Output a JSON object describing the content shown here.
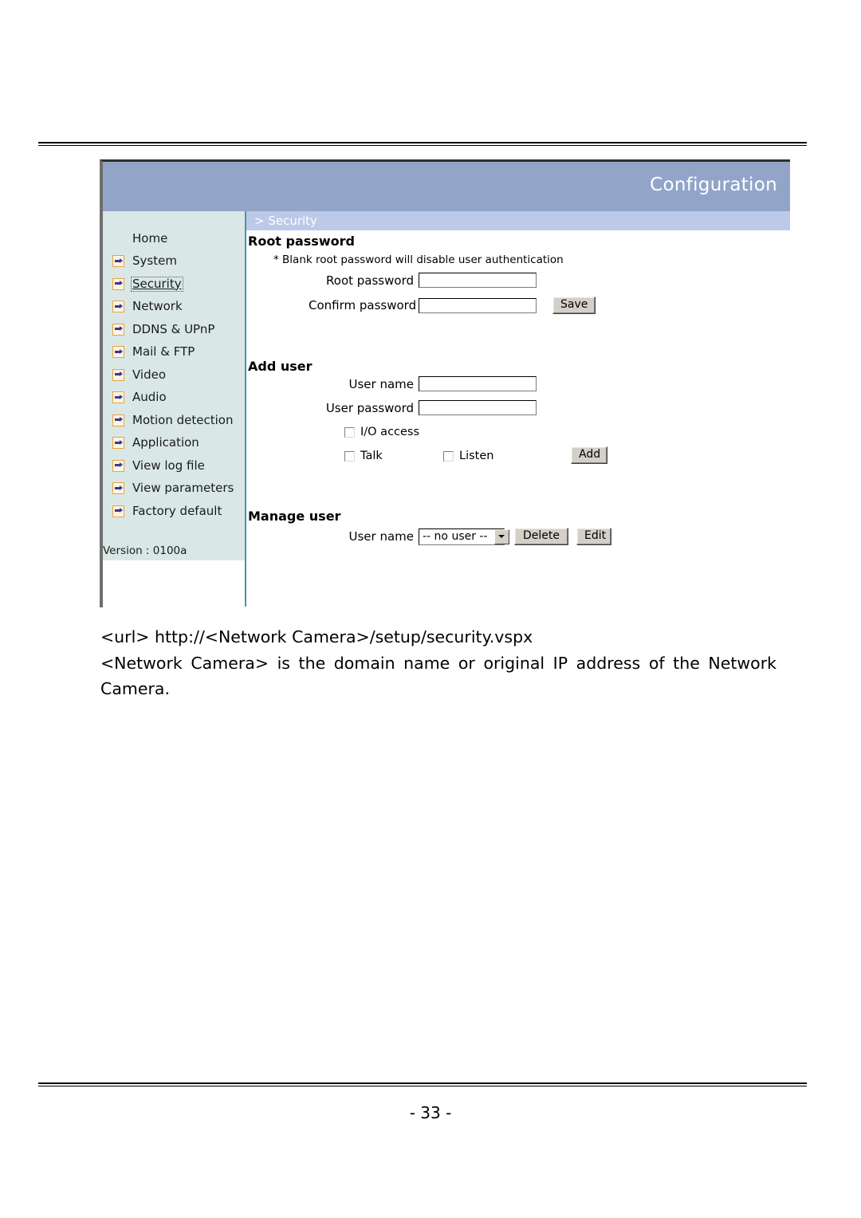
{
  "page": {
    "footer_page_number": "- 33 -"
  },
  "screenshot": {
    "header": {
      "title": "Configuration"
    },
    "breadcrumb": {
      "text": "> Security"
    },
    "sidebar": {
      "items": [
        {
          "label": "Home",
          "icon": "none",
          "active": false
        },
        {
          "label": "System",
          "icon": "arrow-icon",
          "active": false
        },
        {
          "label": "Security",
          "icon": "arrow-icon",
          "active": true
        },
        {
          "label": "Network",
          "icon": "arrow-icon",
          "active": false
        },
        {
          "label": "DDNS & UPnP",
          "icon": "arrow-icon",
          "active": false
        },
        {
          "label": "Mail & FTP",
          "icon": "arrow-icon",
          "active": false
        },
        {
          "label": "Video",
          "icon": "arrow-icon",
          "active": false
        },
        {
          "label": "Audio",
          "icon": "arrow-icon",
          "active": false
        },
        {
          "label": "Motion detection",
          "icon": "arrow-icon",
          "active": false
        },
        {
          "label": "Application",
          "icon": "arrow-icon",
          "active": false
        },
        {
          "label": "View log file",
          "icon": "arrow-icon",
          "active": false
        },
        {
          "label": "View parameters",
          "icon": "arrow-icon",
          "active": false
        },
        {
          "label": "Factory default",
          "icon": "arrow-icon",
          "active": false
        }
      ],
      "version": "Version : 0100a"
    },
    "root_password_section": {
      "title": "Root password",
      "hint": "* Blank root password will disable user authentication",
      "root_password_label": "Root password",
      "root_password_value": "",
      "confirm_password_label": "Confirm password",
      "confirm_password_value": "",
      "save_button": "Save"
    },
    "add_user_section": {
      "title": "Add user",
      "user_name_label": "User name",
      "user_name_value": "",
      "user_password_label": "User password",
      "user_password_value": "",
      "io_access_label": "I/O access",
      "io_access_checked": false,
      "talk_label": "Talk",
      "talk_checked": false,
      "listen_label": "Listen",
      "listen_checked": false,
      "add_button": "Add"
    },
    "manage_user_section": {
      "title": "Manage user",
      "user_name_label": "User name",
      "user_select_value": "-- no user --",
      "delete_button": "Delete",
      "edit_button": "Edit"
    },
    "colors": {
      "header_bar": "#92a5c8",
      "breadcrumb_bar": "#bcc9e8",
      "sidebar_bg": "#d9e8e7",
      "divider": "#4a93a8",
      "icon_border": "#e8a33d",
      "icon_arrow": "#39388e"
    }
  },
  "body": {
    "url_line": "<url> http://<Network Camera>/setup/security.vspx",
    "description": "<Network Camera> is the domain name or original IP address of the Network Camera."
  }
}
